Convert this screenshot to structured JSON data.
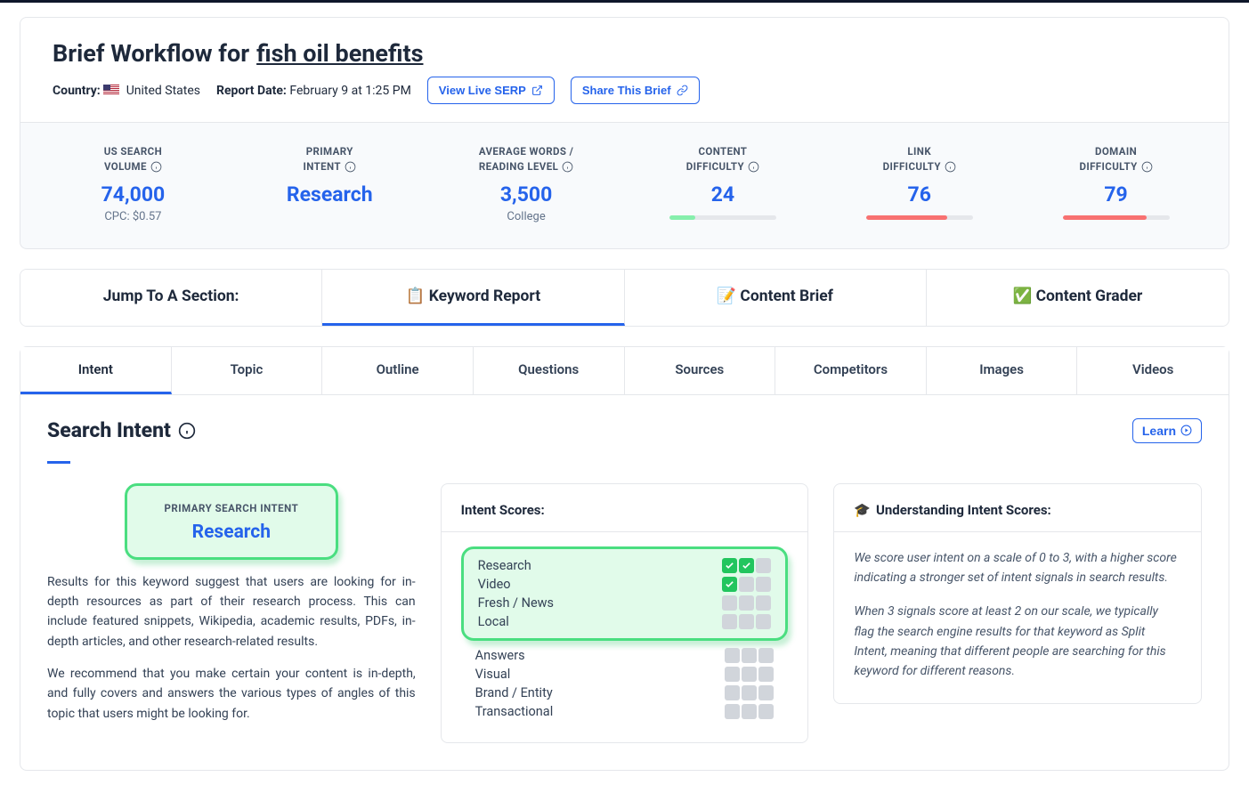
{
  "header": {
    "title_prefix": "Brief Workflow for ",
    "keyword": "fish oil benefits",
    "country_label": "Country:",
    "country_value": "United States",
    "report_date_label": "Report Date:",
    "report_date_value": "February 9 at 1:25 PM",
    "view_serp_btn": "View Live SERP",
    "share_btn": "Share This Brief"
  },
  "metrics": {
    "volume": {
      "label_line1": "US SEARCH",
      "label_line2": "VOLUME",
      "value": "74,000",
      "sub": "CPC: $0.57"
    },
    "intent": {
      "label_line1": "PRIMARY",
      "label_line2": "INTENT",
      "value": "Research"
    },
    "words": {
      "label_line1": "AVERAGE WORDS /",
      "label_line2": "READING LEVEL",
      "value": "3,500",
      "sub": "College"
    },
    "content_diff": {
      "label_line1": "CONTENT",
      "label_line2": "DIFFICULTY",
      "value": "24",
      "pct": 24,
      "color": "green"
    },
    "link_diff": {
      "label_line1": "LINK",
      "label_line2": "DIFFICULTY",
      "value": "76",
      "pct": 76,
      "color": "red"
    },
    "domain_diff": {
      "label_line1": "DOMAIN",
      "label_line2": "DIFFICULTY",
      "value": "79",
      "pct": 79,
      "color": "red"
    }
  },
  "section_nav": {
    "jump_label": "Jump To A Section:",
    "items": [
      {
        "icon": "📋",
        "label": "Keyword Report",
        "active": true
      },
      {
        "icon": "📝",
        "label": "Content Brief",
        "active": false
      },
      {
        "icon": "✅",
        "label": "Content Grader",
        "active": false
      }
    ]
  },
  "tabs": [
    "Intent",
    "Topic",
    "Outline",
    "Questions",
    "Sources",
    "Competitors",
    "Images",
    "Videos"
  ],
  "active_tab": "Intent",
  "search_intent": {
    "title": "Search Intent",
    "learn_btn": "Learn",
    "primary_label": "PRIMARY SEARCH INTENT",
    "primary_value": "Research",
    "para1": "Results for this keyword suggest that users are looking for in-depth resources as part of their research process. This can include featured snippets, Wikipedia, academic results, PDFs, in-depth articles, and other research-related results.",
    "para2": "We recommend that you make certain your content is in-depth, and fully covers and answers the various types of angles of this topic that users might be looking for."
  },
  "intent_scores": {
    "title": "Intent Scores:",
    "highlighted": [
      {
        "label": "Research",
        "score": 2
      },
      {
        "label": "Video",
        "score": 1
      },
      {
        "label": "Fresh / News",
        "score": 0
      },
      {
        "label": "Local",
        "score": 0
      }
    ],
    "rest": [
      {
        "label": "Answers",
        "score": 0
      },
      {
        "label": "Visual",
        "score": 0
      },
      {
        "label": "Brand / Entity",
        "score": 0
      },
      {
        "label": "Transactional",
        "score": 0
      }
    ]
  },
  "understanding": {
    "title": "Understanding Intent Scores:",
    "para1": "We score user intent on a scale of 0 to 3, with a higher score indicating a stronger set of intent signals in search results.",
    "para2": "When 3 signals score at least 2 on our scale, we typically flag the search engine results for that keyword as Split Intent, meaning that different people are searching for this keyword for different reasons."
  }
}
